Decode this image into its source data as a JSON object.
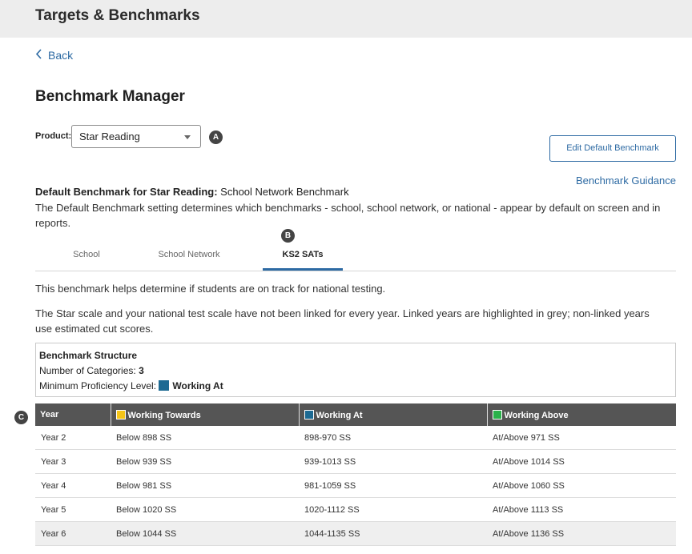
{
  "header": {
    "title": "Targets & Benchmarks"
  },
  "back": {
    "label": "Back"
  },
  "page": {
    "title": "Benchmark Manager"
  },
  "product": {
    "label": "Product:",
    "selected": "Star Reading"
  },
  "callouts": {
    "a": "A",
    "b": "B",
    "c": "C"
  },
  "actions": {
    "edit_default_label": "Edit Default Benchmark",
    "guidance_label": "Benchmark Guidance"
  },
  "default_benchmark": {
    "label": "Default Benchmark for Star Reading:",
    "value": "School Network Benchmark",
    "description": "The Default Benchmark setting determines which benchmarks - school, school network, or national - appear by default on screen and in reports."
  },
  "tabs": [
    {
      "label": "School",
      "active": false
    },
    {
      "label": "School Network",
      "active": false
    },
    {
      "label": "KS2 SATs",
      "active": true
    }
  ],
  "info": {
    "line1": "This benchmark helps determine if students are on track for national testing.",
    "line2": "The Star scale and your national test scale have not been linked for every year. Linked years are highlighted in grey; non-linked years use estimated cut scores."
  },
  "structure": {
    "heading": "Benchmark Structure",
    "categories_label": "Number of Categories:",
    "categories_value": "3",
    "min_level_label": "Minimum Proficiency Level:",
    "min_level_value": "Working At"
  },
  "colors": {
    "working_towards": "#f5c518",
    "working_at": "#1d6a93",
    "working_above": "#2ab24a",
    "accent": "#2d6aa3"
  },
  "table": {
    "headers": [
      "Year",
      "Working Towards",
      "Working At",
      "Working Above"
    ],
    "rows": [
      {
        "year": "Year 2",
        "towards": "Below 898 SS",
        "at": "898-970 SS",
        "above": "At/Above 971 SS",
        "linked": false
      },
      {
        "year": "Year 3",
        "towards": "Below 939 SS",
        "at": "939-1013 SS",
        "above": "At/Above 1014 SS",
        "linked": false
      },
      {
        "year": "Year 4",
        "towards": "Below 981 SS",
        "at": "981-1059 SS",
        "above": "At/Above 1060 SS",
        "linked": false
      },
      {
        "year": "Year 5",
        "towards": "Below 1020 SS",
        "at": "1020-1112 SS",
        "above": "At/Above 1113 SS",
        "linked": false
      },
      {
        "year": "Year 6",
        "towards": "Below 1044 SS",
        "at": "1044-1135 SS",
        "above": "At/Above 1136 SS",
        "linked": true
      }
    ]
  }
}
